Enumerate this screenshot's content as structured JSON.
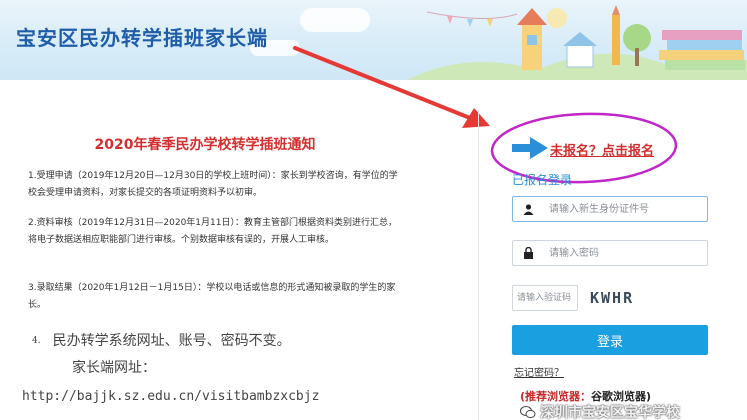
{
  "header": {
    "title": "宝安区民办转学插班家长端"
  },
  "notice": {
    "title": "2020年春季民办学校转学插班通知",
    "item1": "1.受理申请（2019年12月20日—12月30日的学校上班时间）：家长到学校咨询，有学位的学校会受理申请资料，对家长提交的各项证明资料予以初审。",
    "item2": "2.资料审核（2019年12月31日—2020年1月11日）：教育主管部门根据资料类别进行汇总，将电子数据送相应职能部门进行审核。个别数据审核有误的，开展人工审核。",
    "item3": "3.录取结果（2020年1月12日－1月15日）：学校以电话或信息的形式通知被录取的学生的家长。",
    "item4_num": "4.",
    "item4_text": "民办转学系统网址、账号、密码不变。",
    "item4_sub": "家长端网址：",
    "url": "http://bajjk.sz.edu.cn/visitbambzxcbjz"
  },
  "login": {
    "signup_link": "未报名？点击报名",
    "logged_label": "已报名登录",
    "id_placeholder": "请输入新生身份证件号",
    "password_placeholder": "请输入密码",
    "captcha_placeholder": "请输入验证码",
    "captcha_text": "KWHR",
    "login_button": "登录",
    "forgot_password": "忘记密码？",
    "browser_tip_red": "(推荐浏览器：",
    "browser_tip_black": "谷歌浏览器)"
  },
  "watermark": {
    "text": "深圳市宝安区宝华学校"
  },
  "colors": {
    "brand_blue": "#1f5da8",
    "button_blue": "#1a9fe0",
    "red": "#d32f2f",
    "highlight_magenta": "#c026c8"
  }
}
